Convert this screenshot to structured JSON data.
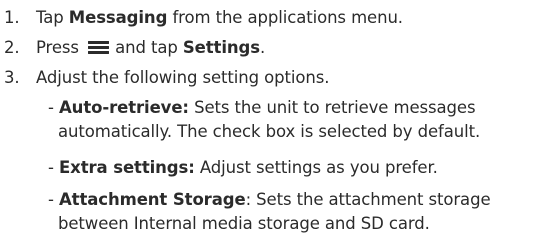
{
  "steps": [
    {
      "num": "1.",
      "pre": "Tap ",
      "bold": "Messaging",
      "post": " from the applications menu."
    },
    {
      "num": "2.",
      "pre": "Press ",
      "icon": "menu-icon",
      "mid": "and tap ",
      "bold": "Settings",
      "post": "."
    },
    {
      "num": "3.",
      "text": "Adjust the following setting options."
    }
  ],
  "options": [
    {
      "dash": "- ",
      "label": "Auto-retrieve:",
      "line1": " Sets the unit to retrieve messages",
      "line2": "automatically. The check box is selected by default."
    },
    {
      "dash": "- ",
      "label": "Extra settings:",
      "line1": " Adjust settings as you prefer."
    },
    {
      "dash": "- ",
      "label": "Attachment Storage",
      "line1": ": Sets the attachment storage",
      "line2": "between Internal media storage and SD card."
    }
  ]
}
